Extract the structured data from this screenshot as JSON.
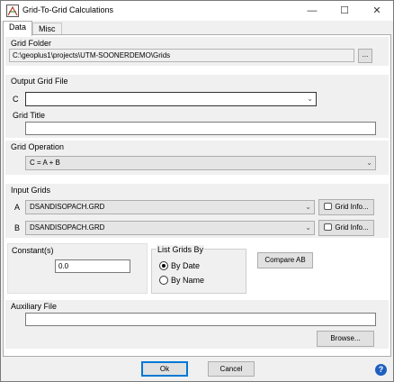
{
  "window": {
    "title": "Grid-To-Grid Calculations",
    "minimize_icon": "minimize-icon",
    "maximize_icon": "maximize-icon",
    "close_icon": "close-icon"
  },
  "tabs": [
    {
      "label": "Data",
      "active": true
    },
    {
      "label": "Misc",
      "active": false
    }
  ],
  "grid_folder": {
    "label": "Grid Folder",
    "path": "C:\\geoplus1\\projects\\UTM-SOONERDEMO\\Grids",
    "browse_label": "..."
  },
  "output_grid": {
    "label": "Output Grid File",
    "prefix": "C",
    "value": "",
    "title_label": "Grid Title",
    "title_value": ""
  },
  "grid_operation": {
    "label": "Grid Operation",
    "selected": "C = A + B"
  },
  "input_grids": {
    "label": "Input Grids",
    "a_prefix": "A",
    "a_value": "DSANDISOPACH.GRD",
    "b_prefix": "B",
    "b_value": "DSANDISOPACH.GRD",
    "info_label": "Grid Info..."
  },
  "constants": {
    "label": "Constant(s)",
    "value": "0.0"
  },
  "list_grids_by": {
    "label": "List Grids By",
    "options": [
      {
        "label": "By Date",
        "selected": true
      },
      {
        "label": "By Name",
        "selected": false
      }
    ]
  },
  "compare_label": "Compare AB",
  "auxiliary": {
    "label": "Auxiliary File",
    "value": "",
    "browse_label": "Browse..."
  },
  "footer": {
    "ok_label": "Ok",
    "cancel_label": "Cancel",
    "help_icon": "help-icon",
    "help_glyph": "?"
  }
}
